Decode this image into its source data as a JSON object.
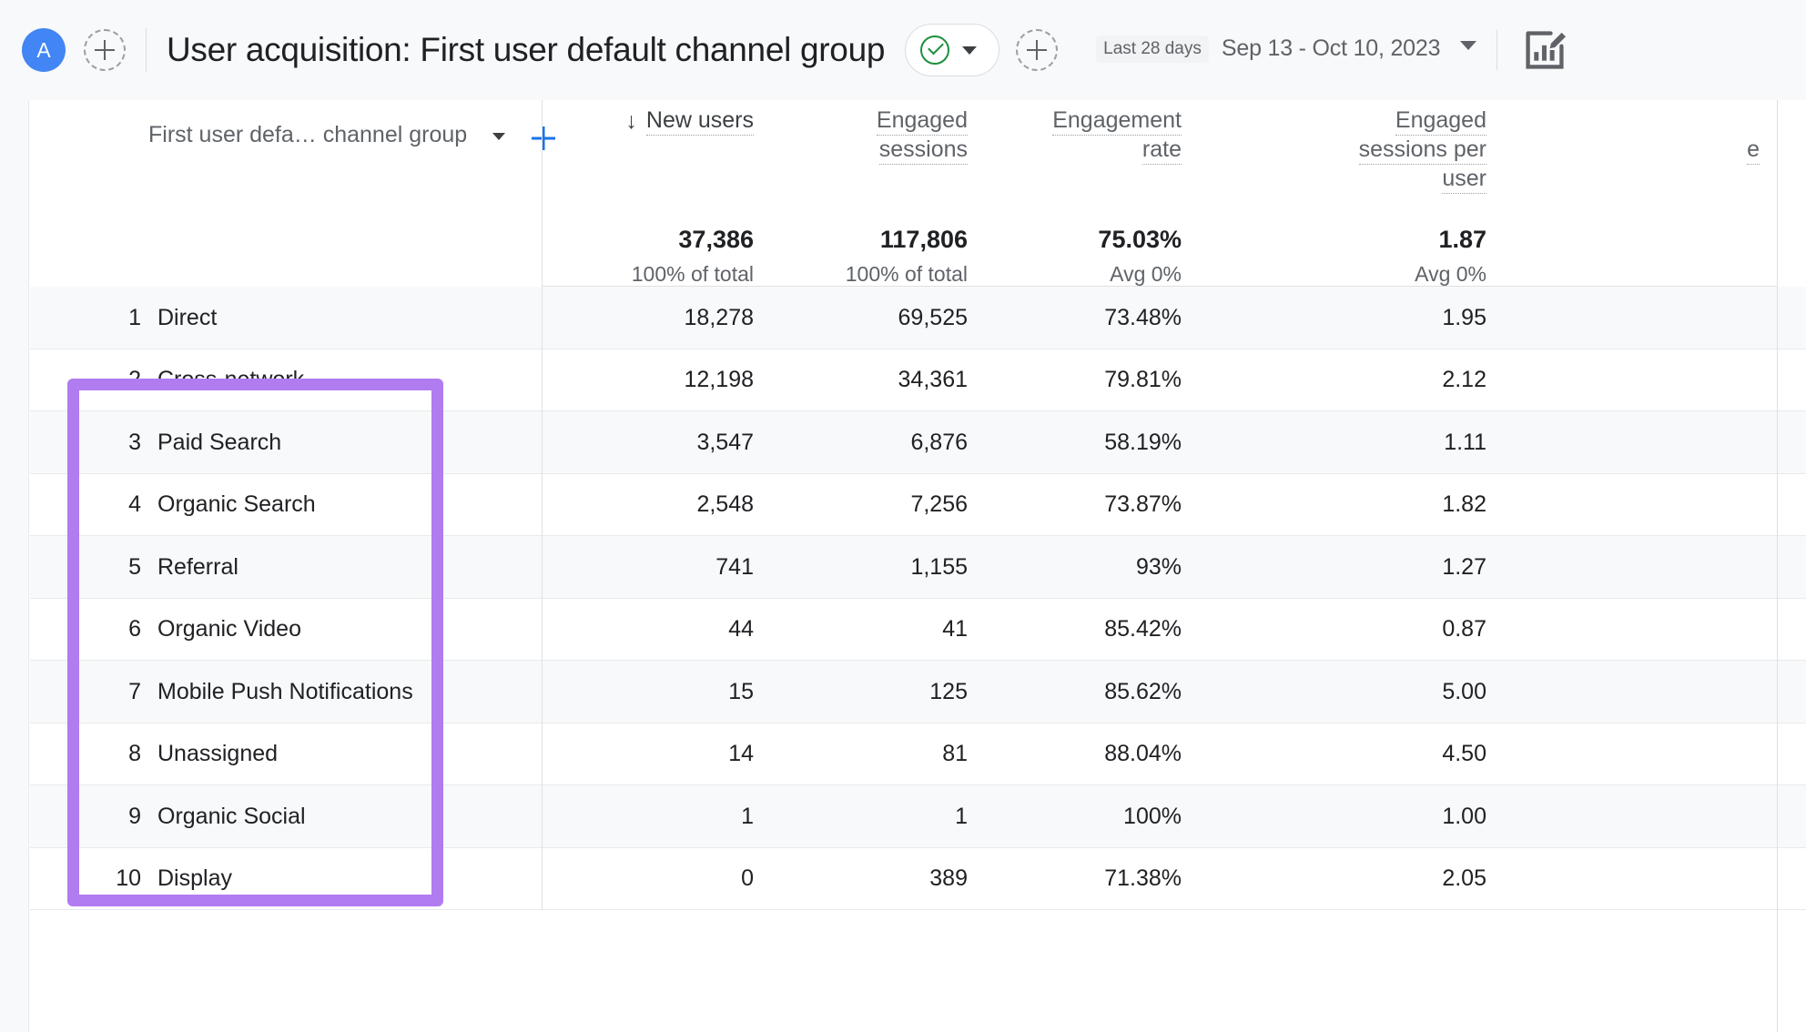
{
  "appbar": {
    "avatar_label": "A",
    "add_account_icon": "plus-icon",
    "title": "User acquisition: First user default channel group",
    "comparison_icon": "check-circle-icon",
    "comparison_caret": "chevron-down-icon",
    "add_comparison_icon": "plus-icon",
    "date_chip": "Last 28 days",
    "date_range": "Sep 13 - Oct 10, 2023",
    "date_caret": "chevron-down-icon",
    "edit_icon": "edit-report-icon"
  },
  "table": {
    "dimension": {
      "label": "First user defa… channel group",
      "caret": "chevron-down-icon",
      "add_dimension_icon": "plus-icon"
    },
    "columns": [
      {
        "label_line1": "New users",
        "label_line2": "",
        "label_line3": "",
        "sorted": true,
        "sort_icon": "↓"
      },
      {
        "label_line1": "Engaged",
        "label_line2": "sessions",
        "label_line3": "",
        "sorted": false,
        "sort_icon": ""
      },
      {
        "label_line1": "Engagement",
        "label_line2": "rate",
        "label_line3": "",
        "sorted": false,
        "sort_icon": ""
      },
      {
        "label_line1": "Engaged",
        "label_line2": "sessions per",
        "label_line3": "user",
        "sorted": false,
        "sort_icon": ""
      },
      {
        "label_line1": "e",
        "label_line2": "",
        "label_line3": "",
        "sorted": false,
        "sort_icon": ""
      }
    ],
    "totals": [
      {
        "value": "37,386",
        "sub": "100% of total"
      },
      {
        "value": "117,806",
        "sub": "100% of total"
      },
      {
        "value": "75.03%",
        "sub": "Avg 0%"
      },
      {
        "value": "1.87",
        "sub": "Avg 0%"
      }
    ],
    "rows": [
      {
        "index": "1",
        "name": "Direct",
        "new_users": "18,278",
        "engaged_sessions": "69,525",
        "engagement_rate": "73.48%",
        "sessions_per_user": "1.95"
      },
      {
        "index": "2",
        "name": "Cross-network",
        "new_users": "12,198",
        "engaged_sessions": "34,361",
        "engagement_rate": "79.81%",
        "sessions_per_user": "2.12"
      },
      {
        "index": "3",
        "name": "Paid Search",
        "new_users": "3,547",
        "engaged_sessions": "6,876",
        "engagement_rate": "58.19%",
        "sessions_per_user": "1.11"
      },
      {
        "index": "4",
        "name": "Organic Search",
        "new_users": "2,548",
        "engaged_sessions": "7,256",
        "engagement_rate": "73.87%",
        "sessions_per_user": "1.82"
      },
      {
        "index": "5",
        "name": "Referral",
        "new_users": "741",
        "engaged_sessions": "1,155",
        "engagement_rate": "93%",
        "sessions_per_user": "1.27"
      },
      {
        "index": "6",
        "name": "Organic Video",
        "new_users": "44",
        "engaged_sessions": "41",
        "engagement_rate": "85.42%",
        "sessions_per_user": "0.87"
      },
      {
        "index": "7",
        "name": "Mobile Push Notifications",
        "new_users": "15",
        "engaged_sessions": "125",
        "engagement_rate": "85.62%",
        "sessions_per_user": "5.00"
      },
      {
        "index": "8",
        "name": "Unassigned",
        "new_users": "14",
        "engaged_sessions": "81",
        "engagement_rate": "88.04%",
        "sessions_per_user": "4.50"
      },
      {
        "index": "9",
        "name": "Organic Social",
        "new_users": "1",
        "engaged_sessions": "1",
        "engagement_rate": "100%",
        "sessions_per_user": "1.00"
      },
      {
        "index": "10",
        "name": "Display",
        "new_users": "0",
        "engaged_sessions": "389",
        "engagement_rate": "71.38%",
        "sessions_per_user": "2.05"
      }
    ]
  },
  "annotation": {
    "highlight_color": "#b07cf0",
    "highlight_target": "dimension-column-rows-1-to-10"
  }
}
